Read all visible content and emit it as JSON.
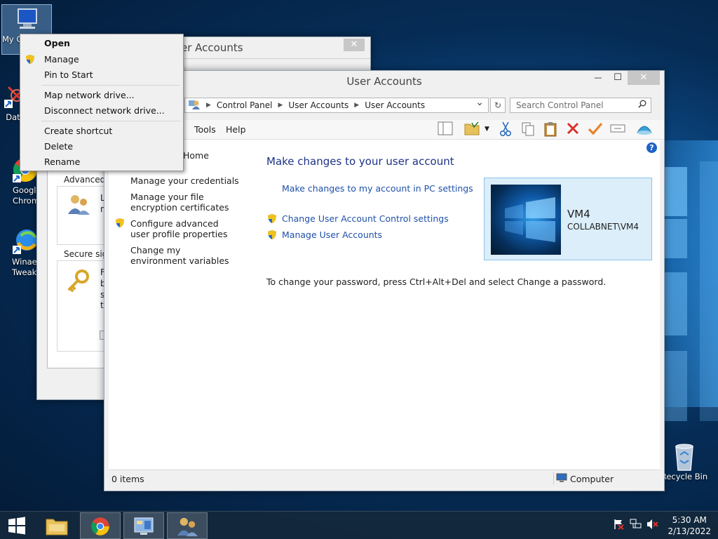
{
  "colors": {
    "link": "#1f51a8",
    "heading": "#1e3287",
    "card_bg": "#dbeef9"
  },
  "desktop": {
    "icons": [
      {
        "label": "My C",
        "icon": "computer-icon"
      },
      {
        "label": "Data",
        "icon": "app-shortcut-icon"
      },
      {
        "label_line1": "Googl",
        "label_line2": "Chrom",
        "icon": "chrome-icon"
      },
      {
        "label_line1": "Winae",
        "label_line2": "Tweak",
        "icon": "winaero-icon"
      },
      {
        "label": "Recycle Bin",
        "icon": "recycle-bin-icon"
      }
    ]
  },
  "back_window": {
    "title": "er Accounts",
    "close_symbol": "✕",
    "advanced_label": "Advanced",
    "advanced_text_a": "L",
    "advanced_text_b": "n",
    "secure_label": "Secure sign",
    "secure_lines": [
      "F",
      "b",
      "s",
      "tl"
    ]
  },
  "context_menu": {
    "items": [
      "Open",
      "Manage",
      "Pin to Start",
      "Map network drive...",
      "Disconnect network drive...",
      "Create shortcut",
      "Delete",
      "Rename"
    ]
  },
  "main_window": {
    "title": "User Accounts",
    "minimize_symbol": "—",
    "maximize_symbol": "☐",
    "close_symbol": "✕",
    "address": {
      "crumbs": [
        "Control Panel",
        "User Accounts",
        "User Accounts"
      ],
      "separator": "▶",
      "dropdown_symbol": "⌄",
      "refresh_symbol": "↻"
    },
    "search": {
      "placeholder": "Search Control Panel",
      "icon": "search-icon"
    },
    "menu": {
      "tools": "Tools",
      "help": "Help"
    },
    "help_symbol": "?",
    "left_panel": {
      "home": "Home",
      "links": [
        "Manage your credentials",
        "Manage your file encryption certificates",
        "Configure advanced user profile properties",
        "Change my environment variables"
      ]
    },
    "main": {
      "heading": "Make changes to your user account",
      "pc_settings_link": "Make changes to my account in PC settings",
      "uac_link": "Change User Account Control settings",
      "manage_link": "Manage User Accounts",
      "password_note": "To change your password, press Ctrl+Alt+Del and select Change a password."
    },
    "user": {
      "name": "VM4",
      "domain": "COLLABNET\\VM4"
    },
    "status": {
      "items": "0 items",
      "location": "Computer"
    }
  },
  "taskbar": {
    "time": "5:30 AM",
    "date": "2/13/2022"
  }
}
